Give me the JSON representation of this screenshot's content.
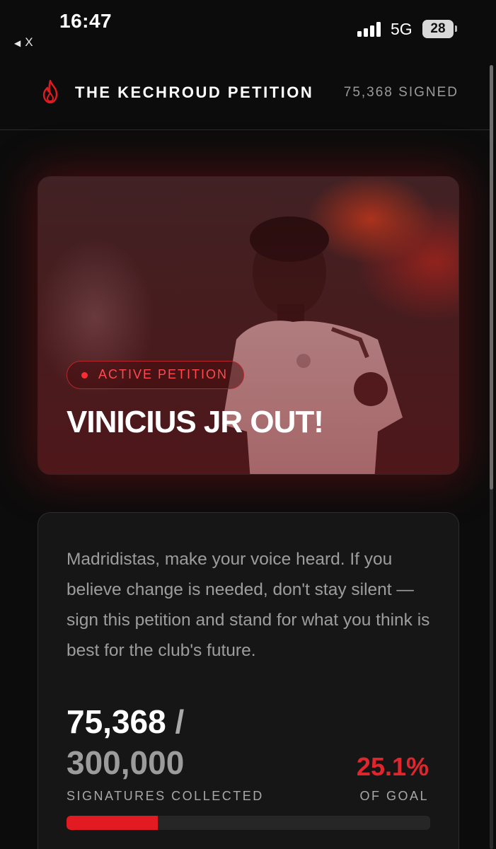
{
  "status_bar": {
    "time": "16:47",
    "back_label": "X",
    "network": "5G",
    "battery": "28"
  },
  "header": {
    "title": "THE KECHROUD PETITION",
    "signed": "75,368 SIGNED"
  },
  "hero": {
    "badge": "ACTIVE PETITION",
    "title": "VINICIUS JR OUT!"
  },
  "card": {
    "description": "Madridistas, make your voice heard. If you believe change is needed, don't stay silent — sign this petition and stand for what you think is best for the club's future.",
    "count": "75,368",
    "slash": " /",
    "goal": "300,000",
    "percent": "25.1%",
    "collected_label": "SIGNATURES COLLECTED",
    "goal_label": "OF GOAL",
    "progress": 0.251
  },
  "colors": {
    "accent": "#e21b22",
    "background": "#0c0c0c",
    "card": "#161616"
  }
}
